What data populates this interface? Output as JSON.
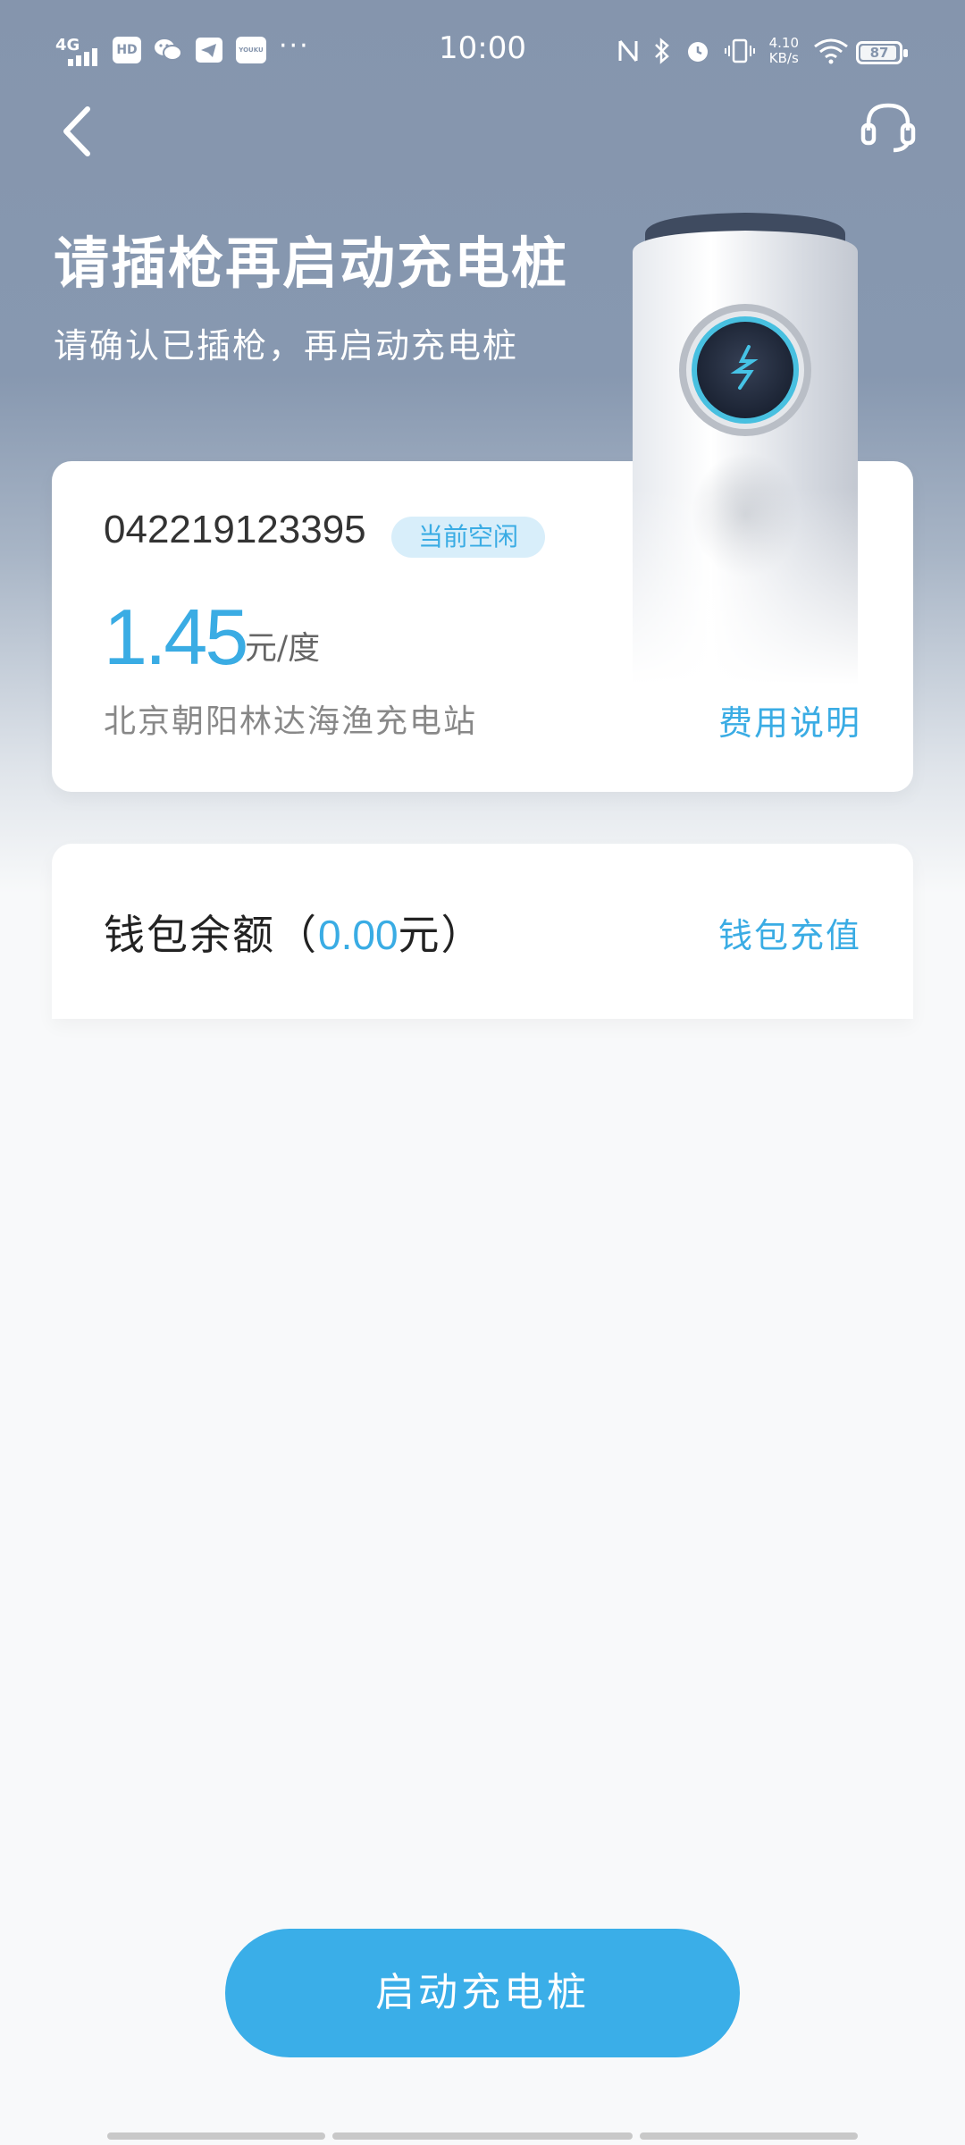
{
  "status_bar": {
    "network": "4G",
    "hd_badge": "HD",
    "youku_badge": "YOUKU",
    "more": "···",
    "time": "10:00",
    "speed_value": "4.10",
    "speed_unit": "KB/s",
    "battery": "87"
  },
  "header": {
    "title": "请插枪再启动充电桩",
    "subtitle": "请确认已插枪，再启动充电桩"
  },
  "pile_card": {
    "pile_id": "042219123395",
    "status": "当前空闲",
    "price": "1.45",
    "price_unit": "元/度",
    "station": "北京朝阳林达海渔充电站",
    "fee_link": "费用说明"
  },
  "wallet": {
    "label_prefix": "钱包余额（",
    "balance": "0.00",
    "label_suffix": "元）",
    "topup": "钱包充值"
  },
  "actions": {
    "start": "启动充电桩"
  },
  "colors": {
    "accent": "#3aace4",
    "hero_bg": "#8595ad",
    "page_bg": "#f8f9fa"
  },
  "icons": {
    "back": "chevron-left-icon",
    "support": "headset-icon"
  }
}
